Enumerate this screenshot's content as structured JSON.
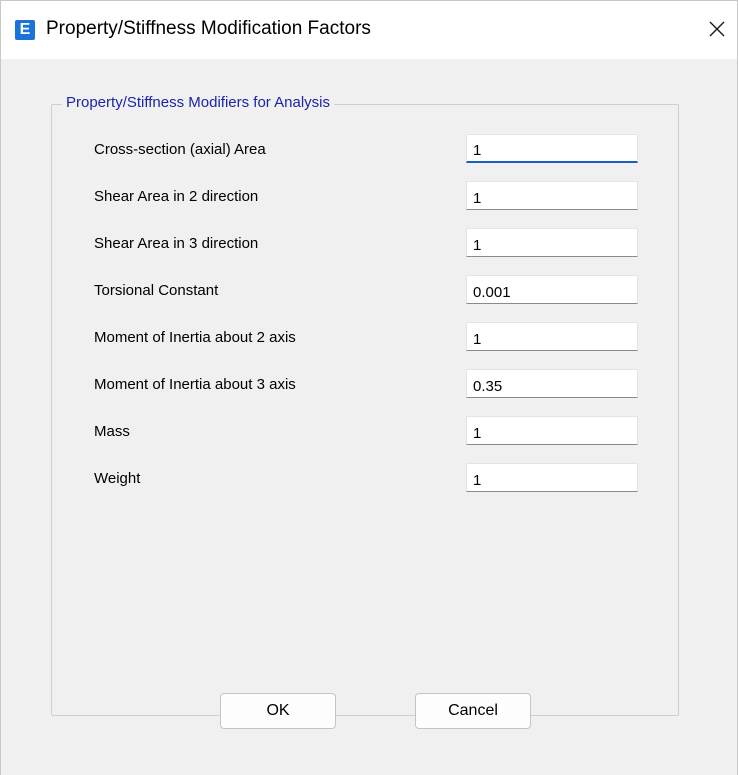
{
  "window": {
    "title": "Property/Stiffness Modification Factors",
    "app_icon_letter": "E",
    "close_glyph": "×",
    "accent_color": "#1a73d9"
  },
  "group": {
    "legend": "Property/Stiffness Modifiers for Analysis",
    "legend_color": "#1c24a8",
    "rows": [
      {
        "label": "Cross-section (axial) Area",
        "value": "1"
      },
      {
        "label": "Shear Area in 2 direction",
        "value": "1"
      },
      {
        "label": "Shear Area in 3 direction",
        "value": "1"
      },
      {
        "label": "Torsional Constant",
        "value": "0.001"
      },
      {
        "label": "Moment of Inertia about 2 axis",
        "value": "1"
      },
      {
        "label": "Moment of Inertia about 3 axis",
        "value": "0.35"
      },
      {
        "label": "Mass",
        "value": "1"
      },
      {
        "label": "Weight",
        "value": "1"
      }
    ]
  },
  "buttons": {
    "ok_label": "OK",
    "cancel_label": "Cancel"
  }
}
